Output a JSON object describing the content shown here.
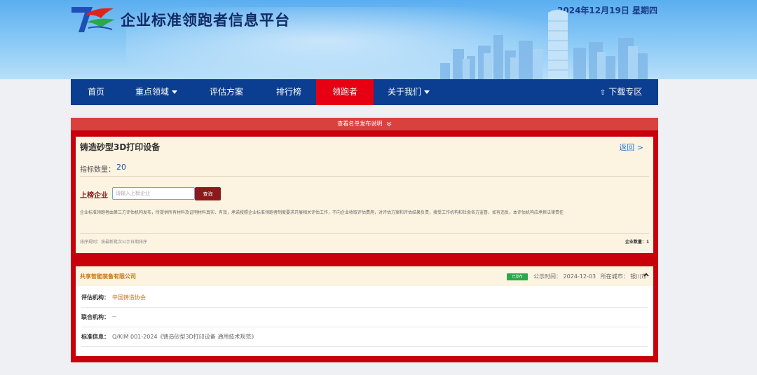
{
  "header": {
    "site_title": "企业标准领跑者信息平台",
    "date": "2024年12月19日 星期四"
  },
  "nav": {
    "items": [
      {
        "label": "首页",
        "has_dropdown": false,
        "active": false
      },
      {
        "label": "重点领域",
        "has_dropdown": true,
        "active": false
      },
      {
        "label": "评估方案",
        "has_dropdown": false,
        "active": false
      },
      {
        "label": "排行榜",
        "has_dropdown": false,
        "active": false
      },
      {
        "label": "领跑者",
        "has_dropdown": false,
        "active": true
      },
      {
        "label": "关于我们",
        "has_dropdown": true,
        "active": false
      }
    ],
    "download": "下载专区",
    "active_color": "#e60012",
    "bar_color": "#0b3d91"
  },
  "notice": {
    "label": "查看名单发布说明"
  },
  "product": {
    "title": "铸造砂型3D打印设备",
    "back": "返回 >",
    "indicator_label": "指标数量：",
    "indicator_count": "20",
    "search_label": "上榜企业",
    "search_placeholder": "请输入上榜企业",
    "search_value": "",
    "query_button": "查询",
    "disclaimer": "企业标准领跑者由第三方评估机构发布，所提供所有材料及证明材料真实、有效，承诺按照企业标准领跑者制度要求开展相关评估工作，不向企业收取评估费用，对评估方案和评估结果负责，接受工作机构和社会各方监督，如有违反，本评估机构应承担法律责任",
    "sort_rule": "排序规则：按最新批次公示日期排序",
    "enterprise_count": "企业数量：1"
  },
  "result": {
    "company": "共享智能装备有限公司",
    "status": "已发布",
    "publish_label": "公示时间：",
    "publish_date": "2024-12-03",
    "city_label": "所在城市：",
    "city": "银川市",
    "rows": [
      {
        "label": "评估机构：",
        "value": "中国铸造协会",
        "color": "#c17a1a"
      },
      {
        "label": "联合机构：",
        "value": "--",
        "color": "#666666"
      },
      {
        "label": "标准信息：",
        "value": "Q/KIM 001-2024《铸造砂型3D打印设备 通用技术规范》",
        "color": "#666666"
      }
    ],
    "status_color": "#2aa84a"
  }
}
